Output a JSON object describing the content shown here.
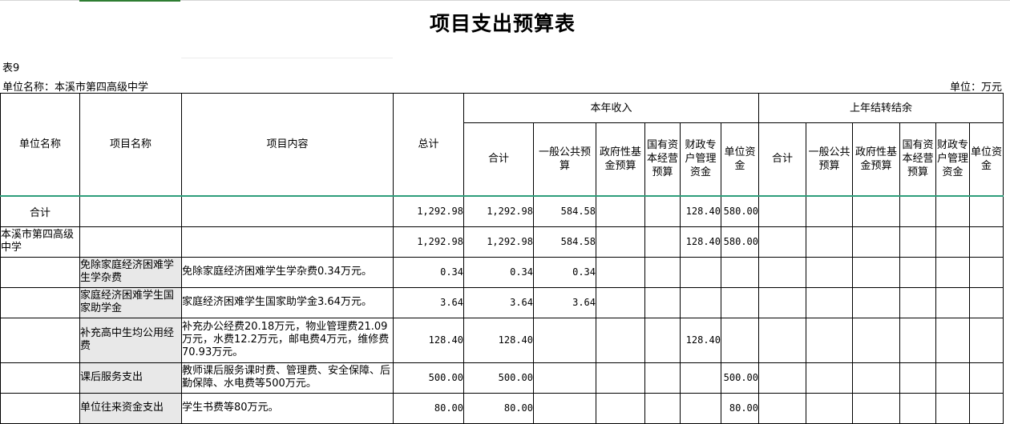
{
  "title": "项目支出预算表",
  "table_no": "表9",
  "unit_label": "单位名称：本溪市第四高级中学",
  "currency_label": "单位：万元",
  "headers": {
    "unit_name": "单位名称",
    "project_name": "项目名称",
    "project_content": "项目内容",
    "total": "总计",
    "current_income": "本年收入",
    "carryover": "上年结转结余",
    "sub": {
      "sum": "合计",
      "general": "一般公共预算",
      "fund": "政府性基金预算",
      "soe": "国有资本经营预算",
      "fiscal": "财政专户管理资金",
      "unit_funds": "单位资金"
    }
  },
  "rows": [
    {
      "unit": "合计",
      "project": "",
      "content": "",
      "total": "1,292.98",
      "inc_sum": "1,292.98",
      "inc_general": "584.58",
      "inc_fund": "",
      "inc_soe": "",
      "inc_fiscal": "128.40",
      "inc_unit": "580.00"
    },
    {
      "unit": "本溪市第四高级中学",
      "project": "",
      "content": "",
      "total": "1,292.98",
      "inc_sum": "1,292.98",
      "inc_general": "584.58",
      "inc_fund": "",
      "inc_soe": "",
      "inc_fiscal": "128.40",
      "inc_unit": "580.00"
    },
    {
      "unit": "",
      "project": "免除家庭经济困难学生学杂费",
      "content": "免除家庭经济困难学生学杂费0.34万元。",
      "total": "0.34",
      "inc_sum": "0.34",
      "inc_general": "0.34",
      "inc_fund": "",
      "inc_soe": "",
      "inc_fiscal": "",
      "inc_unit": ""
    },
    {
      "unit": "",
      "project": "家庭经济困难学生国家助学金",
      "content": "家庭经济困难学生国家助学金3.64万元。",
      "total": "3.64",
      "inc_sum": "3.64",
      "inc_general": "3.64",
      "inc_fund": "",
      "inc_soe": "",
      "inc_fiscal": "",
      "inc_unit": ""
    },
    {
      "unit": "",
      "project": "补充高中生均公用经费",
      "content": "补充办公经费20.18万元，物业管理费21.09万元，水费12.2万元，邮电费4万元，维修费70.93万元。",
      "total": "128.40",
      "inc_sum": "128.40",
      "inc_general": "",
      "inc_fund": "",
      "inc_soe": "",
      "inc_fiscal": "128.40",
      "inc_unit": ""
    },
    {
      "unit": "",
      "project": "课后服务支出",
      "content": "教师课后服务课时费、管理费、安全保障、后勤保障、水电费等500万元。",
      "total": "500.00",
      "inc_sum": "500.00",
      "inc_general": "",
      "inc_fund": "",
      "inc_soe": "",
      "inc_fiscal": "",
      "inc_unit": "500.00"
    },
    {
      "unit": "",
      "project": "单位往来资金支出",
      "content": "学生书费等80万元。",
      "total": "80.00",
      "inc_sum": "80.00",
      "inc_general": "",
      "inc_fund": "",
      "inc_soe": "",
      "inc_fiscal": "",
      "inc_unit": "80.00"
    }
  ]
}
